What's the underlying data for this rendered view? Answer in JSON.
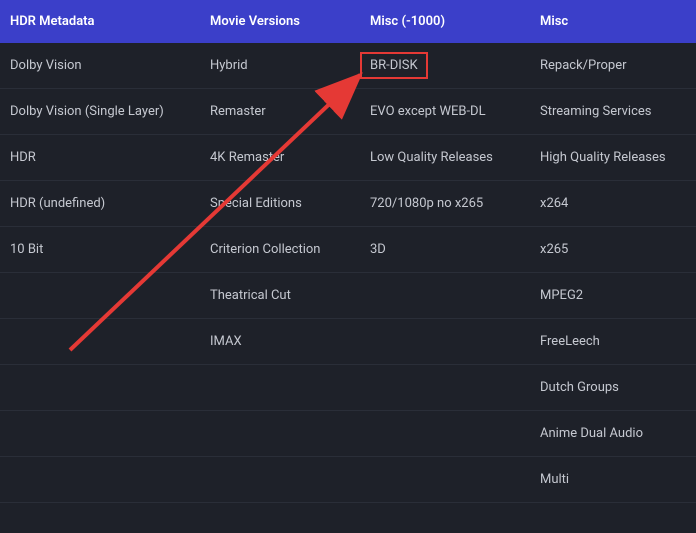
{
  "headers": [
    "HDR Metadata",
    "Movie Versions",
    "Misc (-1000)",
    "Misc"
  ],
  "rows": [
    [
      "Dolby Vision",
      "Hybrid",
      "BR-DISK",
      "Repack/Proper"
    ],
    [
      "Dolby Vision (Single Layer)",
      "Remaster",
      "EVO except WEB-DL",
      "Streaming Services"
    ],
    [
      "HDR",
      "4K Remaster",
      "Low Quality Releases",
      "High Quality Releases"
    ],
    [
      "HDR (undefined)",
      "Special Editions",
      "720/1080p no x265",
      "x264"
    ],
    [
      "10 Bit",
      "Criterion Collection",
      "3D",
      "x265"
    ],
    [
      "",
      "Theatrical Cut",
      "",
      "MPEG2"
    ],
    [
      "",
      "IMAX",
      "",
      "FreeLeech"
    ],
    [
      "",
      "",
      "",
      "Dutch Groups"
    ],
    [
      "",
      "",
      "",
      "Anime Dual Audio"
    ],
    [
      "",
      "",
      "",
      "Multi"
    ]
  ],
  "highlight": {
    "row": 0,
    "col": 2
  },
  "annotation_color": "#e53935"
}
